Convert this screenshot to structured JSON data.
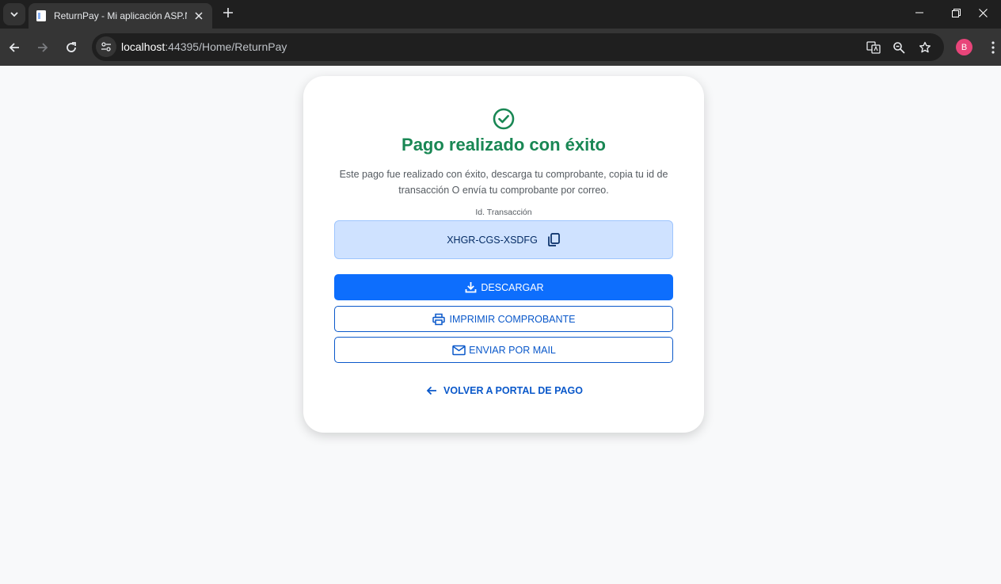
{
  "browser": {
    "tab_title": "ReturnPay - Mi aplicación ASP.NET",
    "url_host": "localhost",
    "url_rest": ":44395/Home/ReturnPay",
    "profile_initial": "B"
  },
  "page": {
    "title": "Pago realizado con éxito",
    "description": "Este pago fue realizado con éxito, descarga tu comprobante, copia tu id de transacción O envía tu comprobante por correo.",
    "transaction_label": "Id. Transacción",
    "transaction_id": "XHGR-CGS-XSDFG",
    "download_label": "DESCARGAR",
    "print_label": "IMPRIMIR COMPROBANTE",
    "mail_label": "ENVIAR POR MAIL",
    "back_label": "VOLVER A PORTAL DE PAGO"
  },
  "colors": {
    "success": "#198754",
    "primary": "#0d6efd",
    "primary_dark": "#0a58ca",
    "txn_bg": "#cfe2ff"
  },
  "icons": [
    "tab-search-icon",
    "page-icon",
    "close-icon",
    "plus-icon",
    "minimize-icon",
    "restore-icon",
    "back-icon",
    "forward-icon",
    "reload-icon",
    "site-info-icon",
    "translate-icon",
    "zoom-icon",
    "bookmark-star-icon",
    "menu-dots-icon",
    "check-circle-icon",
    "copy-icon",
    "download-icon",
    "printer-icon",
    "envelope-icon",
    "arrow-left-icon"
  ]
}
